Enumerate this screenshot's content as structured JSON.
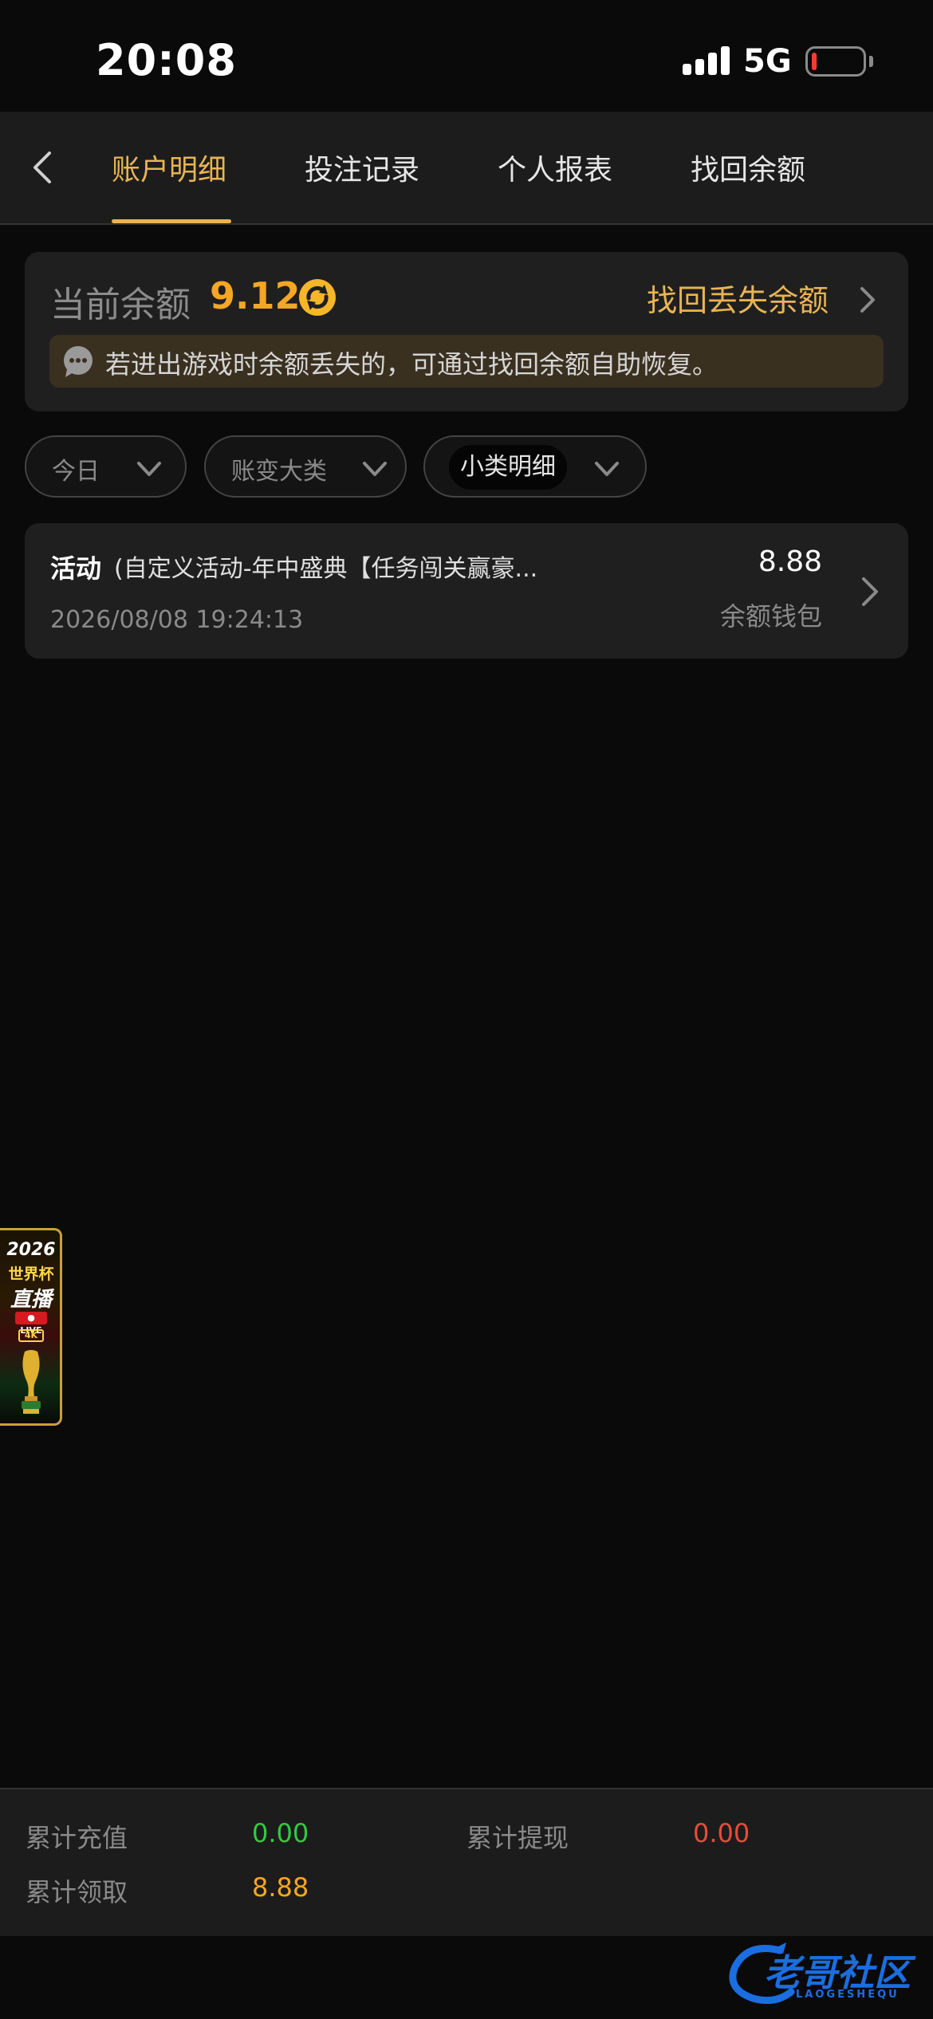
{
  "status_bar": {
    "time": "20:08",
    "network": "5G",
    "battery_level": 0.1,
    "battery_color": "#ff3b30"
  },
  "header": {
    "back_icon": "chevron-left-icon",
    "tabs": [
      {
        "label": "账户明细",
        "active": true
      },
      {
        "label": "投注记录",
        "active": false
      },
      {
        "label": "个人报表",
        "active": false
      },
      {
        "label": "找回余额",
        "active": false
      }
    ],
    "accent_color": "#e8b454"
  },
  "balance": {
    "label": "当前余额",
    "value": "9.12",
    "refresh_icon": "refresh-icon",
    "recover_label": "找回丢失余额",
    "notice_icon": "chat-bubble-icon",
    "notice": "若进出游戏时余额丢失的，可通过找回余额自助恢复。"
  },
  "filters": [
    {
      "label": "今日",
      "icon": "chevron-down-icon"
    },
    {
      "label": "账变大类",
      "icon": "chevron-down-icon"
    },
    {
      "label": "小类明细",
      "icon": "chevron-down-icon"
    }
  ],
  "records": [
    {
      "title": "活动",
      "description": "(自定义活动-年中盛典【任务闯关赢豪...",
      "time": "2026/08/08 19:24:13",
      "amount": "8.88",
      "wallet": "余额钱包"
    }
  ],
  "floating_badge": {
    "year": "2026",
    "line1": "世界杯",
    "line2": "直播",
    "live_tag": "● LIVE",
    "quality": "4K",
    "icon": "trophy-icon"
  },
  "summary": {
    "recharge_label": "累计充值",
    "recharge_value": "0.00",
    "recharge_color": "#2ecc40",
    "withdraw_label": "累计提现",
    "withdraw_value": "0.00",
    "withdraw_color": "#e74c3c",
    "claim_label": "累计领取",
    "claim_value": "8.88",
    "claim_color": "#f5a623"
  },
  "watermark": {
    "text": "老哥社区",
    "subtext": "LAOGESHEQU",
    "icon": "dragon-swirl-icon"
  }
}
